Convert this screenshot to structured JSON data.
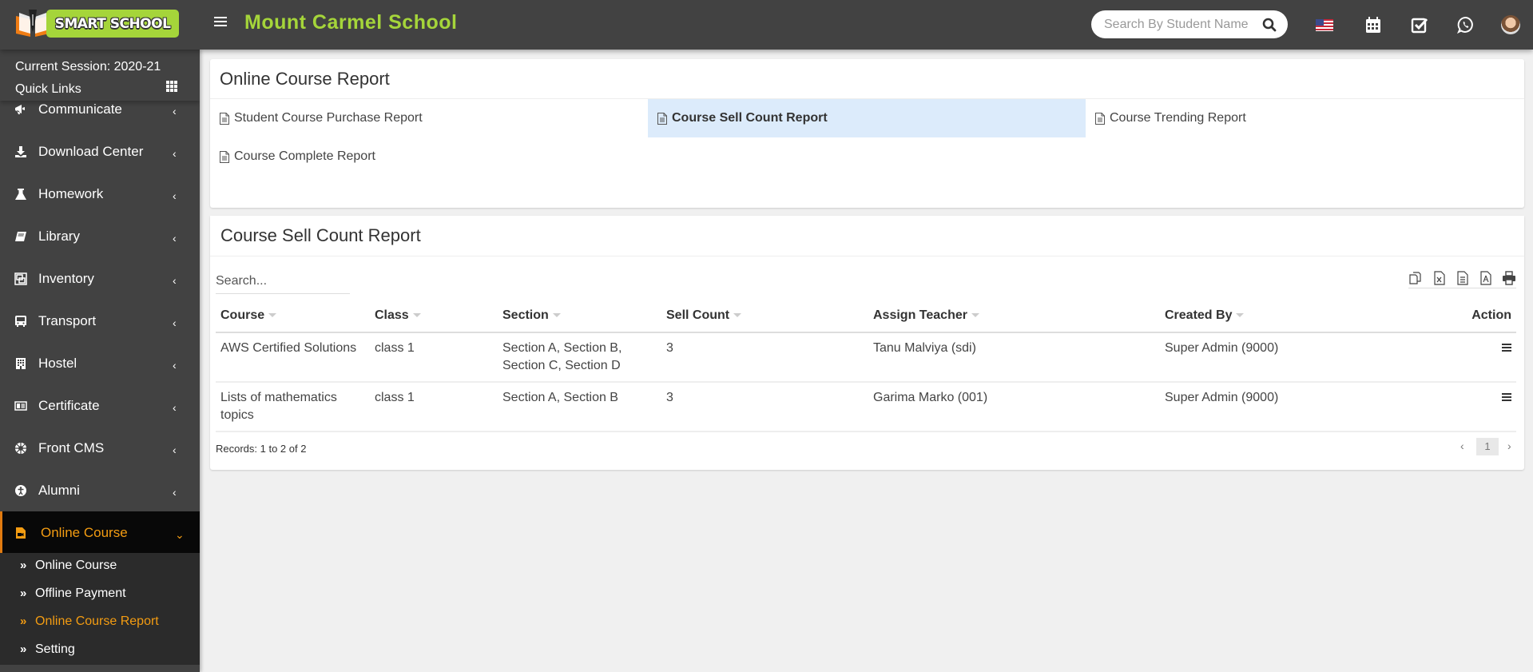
{
  "header": {
    "logo_text": "SMART SCHOOL",
    "school_name": "Mount Carmel School",
    "search_placeholder": "Search By Student Name",
    "icons": [
      "menu-icon",
      "search-icon",
      "us-flag-icon",
      "calendar-icon",
      "checkbox-icon",
      "whatsapp-icon",
      "user-avatar"
    ]
  },
  "sidebar": {
    "session_label": "Current Session: 2020-21",
    "quick_links_label": "Quick Links",
    "items": [
      {
        "label": "Communicate",
        "icon": "bullhorn-icon"
      },
      {
        "label": "Download Center",
        "icon": "download-icon"
      },
      {
        "label": "Homework",
        "icon": "flask-icon"
      },
      {
        "label": "Library",
        "icon": "book-icon"
      },
      {
        "label": "Inventory",
        "icon": "object-group-icon"
      },
      {
        "label": "Transport",
        "icon": "bus-icon"
      },
      {
        "label": "Hostel",
        "icon": "building-icon"
      },
      {
        "label": "Certificate",
        "icon": "id-card-icon"
      },
      {
        "label": "Front CMS",
        "icon": "life-ring-icon"
      },
      {
        "label": "Alumni",
        "icon": "universal-access-icon"
      },
      {
        "label": "Online Course",
        "icon": "file-video-icon",
        "active": true
      }
    ],
    "submenu": [
      {
        "label": "Online Course"
      },
      {
        "label": "Offline Payment"
      },
      {
        "label": "Online Course Report",
        "active": true
      },
      {
        "label": "Setting"
      }
    ]
  },
  "reports_panel": {
    "title": "Online Course Report",
    "links": [
      {
        "label": "Student Course Purchase Report"
      },
      {
        "label": "Course Sell Count Report",
        "active": true
      },
      {
        "label": "Course Trending Report"
      },
      {
        "label": "Course Complete Report"
      }
    ]
  },
  "table_panel": {
    "title": "Course Sell Count Report",
    "search_placeholder": "Search...",
    "tools": [
      "copy-icon",
      "excel-icon",
      "csv-icon",
      "pdf-icon",
      "print-icon"
    ],
    "columns": [
      "Course",
      "Class",
      "Section",
      "Sell Count",
      "Assign Teacher",
      "Created By",
      "Action"
    ],
    "rows": [
      {
        "course": "AWS Certified Solutions",
        "class": "class 1",
        "section": "Section A, Section B, Section C, Section D",
        "sell_count": "3",
        "teacher": "Tanu Malviya (sdi)",
        "created_by": "Super Admin (9000)"
      },
      {
        "course": "Lists of mathematics topics",
        "class": "class 1",
        "section": "Section A, Section B",
        "sell_count": "3",
        "teacher": "Garima Marko (001)",
        "created_by": "Super Admin (9000)"
      }
    ],
    "records_text": "Records: 1 to 2 of 2",
    "pagination": {
      "prev": "‹",
      "current": "1",
      "next": "›"
    }
  },
  "colors": {
    "header_bg": "#424242",
    "brand_green": "#a5d53a",
    "active_orange": "#f39c12",
    "active_report_bg": "#dcebfb"
  }
}
